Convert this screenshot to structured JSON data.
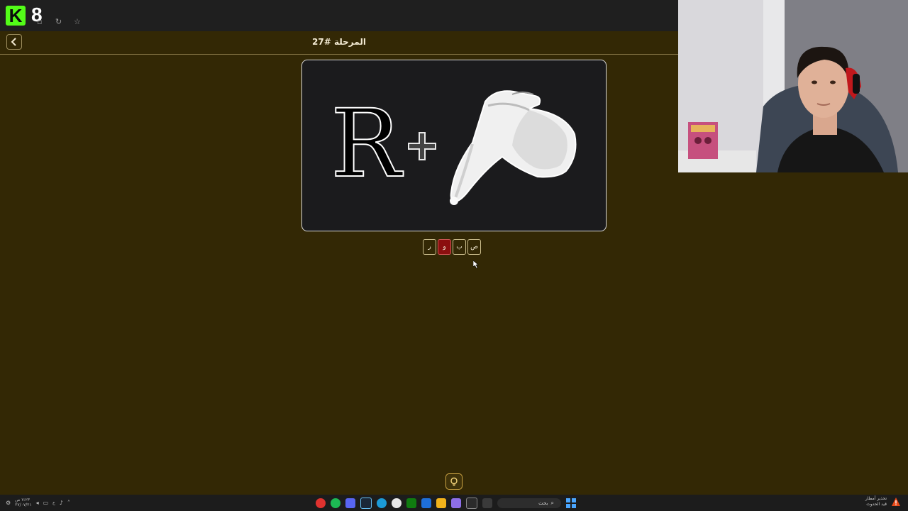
{
  "stream": {
    "overlay_number": "8"
  },
  "header": {
    "level_title": "المرحلة #27"
  },
  "puzzle": {
    "letter": "R",
    "plus": "+"
  },
  "answer_tiles": [
    {
      "letter": "ص",
      "selected": false
    },
    {
      "letter": "ب",
      "selected": false
    },
    {
      "letter": "و",
      "selected": true
    },
    {
      "letter": "ر",
      "selected": false
    }
  ],
  "taskbar": {
    "clock_time": "٧:٢٣ ص",
    "clock_date": "٢٧/٠٧/٢١",
    "lang": "ع",
    "search_placeholder": "بحث",
    "alert_line1": "تحذير أمطار",
    "alert_line2": "قيد الحدوث"
  },
  "colors": {
    "background": "#332805",
    "selected_tile": "#8b0f0f",
    "kick_green": "#53fc18"
  }
}
